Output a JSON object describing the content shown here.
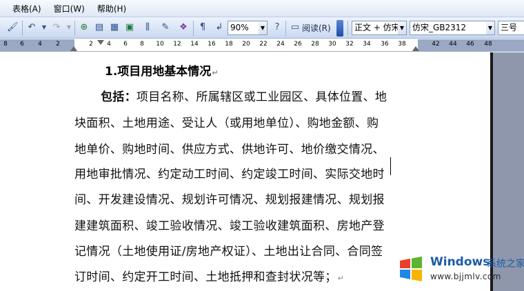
{
  "menubar": {
    "items": [
      {
        "label": "表格(A)"
      },
      {
        "label": "窗口(W)"
      },
      {
        "label": "帮助(H)"
      }
    ]
  },
  "toolbar": {
    "zoom": "90%",
    "read_label": "阅读(R)",
    "style_value": "正文 + 仿宋",
    "font_value": "仿宋_GB2312",
    "size_value": "三号",
    "icons": [
      "format-painter-icon",
      "undo-icon",
      "redo-icon",
      "hyperlink-icon",
      "tables-borders-icon",
      "insert-table-icon",
      "insert-excel-icon",
      "columns-icon",
      "drawing-icon",
      "document-map-icon",
      "show-hide-icon",
      "help-icon",
      "read-icon"
    ]
  },
  "ruler": {
    "labels": [
      "8",
      "6",
      "4",
      "2",
      "2",
      "4",
      "6",
      "8",
      "10",
      "12",
      "14",
      "16",
      "18",
      "20",
      "22",
      "24",
      "26",
      "28",
      "30",
      "32",
      "34",
      "36",
      "38",
      "42",
      "44",
      "46",
      "48"
    ]
  },
  "document": {
    "heading": "1.项目用地基本情况",
    "bold_prefix": "包括：",
    "lines": [
      "项目名称、所属辖区或工业园区、具体位置、地",
      "块面积、土地用途、受让人（或用地单位）、购地金额、购",
      "地单价、购地时间、供应方式、供地许可、地价缴交情况、",
      "用地审批情况、约定动工时间、约定竣工时间、实际交地时",
      "间、开发建设情况、规划许可情况、规划报建情况、规划报",
      "建建筑面积、竣工验收情况、竣工验收建筑面积、房地产登",
      "记情况（土地使用证/房地产权证）、土地出让合同、合同签",
      "订时间、约定开工时间、土地抵押和查封状况等；"
    ],
    "para_mark": "↵"
  },
  "watermark": {
    "title": "Windows",
    "subtitle": "系统之家",
    "url": "www.bjjmlv.com",
    "colors": {
      "red": "#e8402a",
      "green": "#5cb531",
      "blue": "#1e88e5",
      "yellow": "#f7b500"
    }
  }
}
